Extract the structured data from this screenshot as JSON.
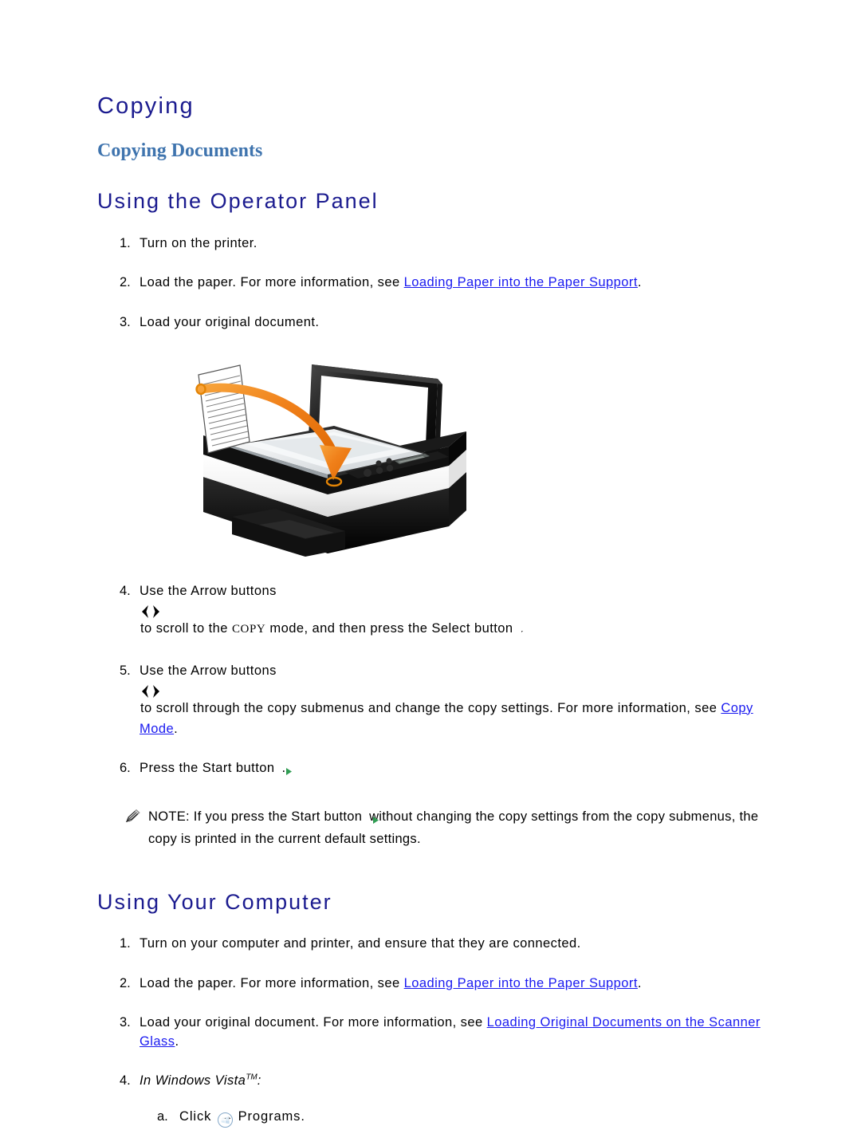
{
  "document": {
    "title": "Copying",
    "subtitle": "Copying Documents"
  },
  "sections": [
    {
      "id": "operator-panel",
      "heading": "Using the Operator Panel",
      "steps": [
        {
          "num": "1.",
          "text": "Turn on the printer."
        },
        {
          "num": "2.",
          "pre": "Load the paper. For more information, see ",
          "link": "Loading Paper into the Paper Support",
          "post": "."
        },
        {
          "num": "3.",
          "text": "Load your original document."
        },
        {
          "num": "4.",
          "seg1": "Use the Arrow buttons ",
          "icon1": "arrows-icon",
          "seg2": "to scroll to the ",
          "mode": "COPY",
          "seg3": " mode, and then press the Select button ",
          "icon2": "select-check-icon",
          "seg4": "."
        },
        {
          "num": "5.",
          "seg1": "Use the Arrow buttons ",
          "icon1": "arrows-icon",
          "seg2": "to scroll through the copy submenus and change the copy settings. For more information, see ",
          "link": "Copy Mode",
          "post": "."
        },
        {
          "num": "6.",
          "seg1": "Press the Start button ",
          "icon1": "start-play-icon",
          "seg2": "."
        }
      ],
      "note": {
        "icon": "note-pencil-icon",
        "label": "NOTE:",
        "seg1": " If you press the Start button ",
        "icon_inline": "start-play-icon",
        "seg2": "without changing the copy settings from the copy submenus, the copy is printed in the current default settings."
      }
    },
    {
      "id": "your-computer",
      "heading": "Using Your Computer",
      "steps": [
        {
          "num": "1.",
          "text": "Turn on your computer and printer, and ensure that they are connected."
        },
        {
          "num": "2.",
          "pre": "Load the paper. For more information, see ",
          "link": "Loading Paper into the Paper Support",
          "post": "."
        },
        {
          "num": "3.",
          "pre": "Load your original document. For more information, see ",
          "link": "Loading Original Documents on the Scanner Glass",
          "post": "."
        },
        {
          "num": "4.",
          "italic_text": "In Windows Vista",
          "tm": "TM",
          "italic_post": ":"
        }
      ],
      "sub_steps": [
        {
          "num": "a.",
          "seg1": "Click ",
          "icon": "windows-vista-start-orb-icon",
          "seg2": "→ Programs."
        }
      ]
    }
  ],
  "figure": {
    "name": "printer-scanner-load-document-illustration",
    "alt": "Illustration of a document being placed face down on the flatbed scanner glass of an all-in-one printer"
  },
  "colors": {
    "heading_navy": "#1b1b8f",
    "subheading_steel": "#3f74ae",
    "link_blue": "#1a1af0",
    "arrow_orange": "#f07d14",
    "body_black": "#000000",
    "start_green": "#2f9c52"
  }
}
